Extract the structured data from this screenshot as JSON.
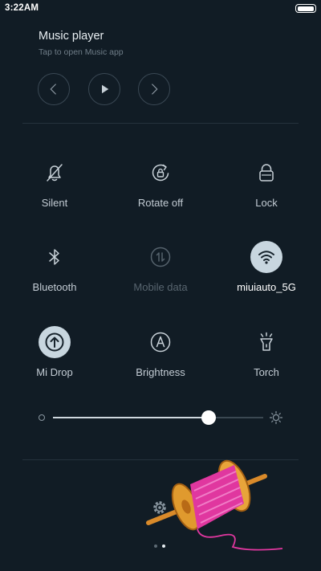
{
  "status_bar": {
    "time": "3:22AM",
    "battery_level": 1.0
  },
  "music_player": {
    "title": "Music player",
    "subtitle": "Tap to open Music app",
    "controls": [
      {
        "icon": "previous-icon"
      },
      {
        "icon": "play-icon"
      },
      {
        "icon": "next-icon"
      }
    ]
  },
  "toggles": [
    {
      "label": "Silent",
      "icon": "bell-off-icon",
      "state": "off"
    },
    {
      "label": "Rotate off",
      "icon": "rotate-lock-icon",
      "state": "off"
    },
    {
      "label": "Lock",
      "icon": "lock-icon",
      "state": "off"
    },
    {
      "label": "Bluetooth",
      "icon": "bluetooth-icon",
      "state": "off"
    },
    {
      "label": "Mobile data",
      "icon": "mobile-data-icon",
      "state": "disabled"
    },
    {
      "label": "miuiauto_5G",
      "icon": "wifi-icon",
      "state": "on"
    },
    {
      "label": "Mi Drop",
      "icon": "mi-drop-icon",
      "state": "on"
    },
    {
      "label": "Brightness",
      "icon": "auto-brightness-icon",
      "state": "off"
    },
    {
      "label": "Torch",
      "icon": "torch-icon",
      "state": "off"
    }
  ],
  "brightness": {
    "level": 0.74
  },
  "pager": {
    "count": 2,
    "active_index": 1
  },
  "colors": {
    "background": "#111c25",
    "active_tile": "#c8d6df",
    "text": "#c3ccd4"
  }
}
